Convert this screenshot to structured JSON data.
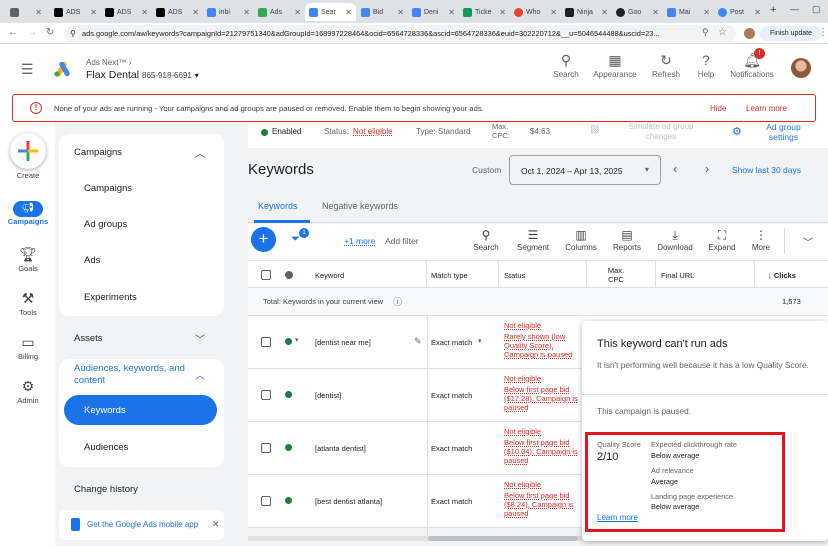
{
  "browser": {
    "tabs": [
      {
        "label": "",
        "color": "#5f6368"
      },
      {
        "label": "ADS",
        "color": "#000"
      },
      {
        "label": "ADS",
        "color": "#000"
      },
      {
        "label": "ADS",
        "color": "#000"
      },
      {
        "label": "inbi",
        "color": "#4285f4"
      },
      {
        "label": "Ads",
        "color": "#34a853"
      },
      {
        "label": "Sear",
        "color": "#4285f4"
      },
      {
        "label": "Bid",
        "color": "#4285f4"
      },
      {
        "label": "Deni",
        "color": "#4285f4"
      },
      {
        "label": "Ticke",
        "color": "#0f9d58"
      },
      {
        "label": "Who",
        "color": "#ea4335"
      },
      {
        "label": "Ninja",
        "color": "#202124"
      },
      {
        "label": "Goo",
        "color": "#202124"
      },
      {
        "label": "Mai",
        "color": "#4285f4"
      },
      {
        "label": "Post",
        "color": "#4285f4"
      }
    ],
    "url": "ads.google.com/aw/keywords?campaignId=21279751340&adGroupId=168997228464&ocid=6564728336&ascid=6564728336&euid=302220712&__u=5046544488&uscid=23...",
    "finish_update": "Finish update"
  },
  "header": {
    "product": "Ads Next™",
    "account_name": "Flax Dental",
    "account_phone": "865-918-6691",
    "search": "Search",
    "appearance": "Appearance",
    "refresh": "Refresh",
    "help": "Help",
    "notifications": "Notifications",
    "notification_count": "!"
  },
  "banner": {
    "message_bold": "None of your ads are running",
    "message": " - Your campaigns and ad groups are paused or removed. Enable them to begin showing your ads.",
    "hide": "Hide",
    "learn_more": "Learn more"
  },
  "rail": {
    "create": "Create",
    "campaigns": "Campaigns",
    "goals": "Goals",
    "tools": "Tools",
    "billing": "Billing",
    "admin": "Admin"
  },
  "nav": {
    "campaigns_section": "Campaigns",
    "campaigns": "Campaigns",
    "ad_groups": "Ad groups",
    "ads": "Ads",
    "experiments": "Experiments",
    "assets": "Assets",
    "audiences_section": "Audiences, keywords, and content",
    "keywords": "Keywords",
    "audiences": "Audiences",
    "change_history": "Change history",
    "mobile_app": "Get the Google Ads mobile app"
  },
  "status_bar": {
    "enabled": "Enabled",
    "status_label": "Status:",
    "status_value": "Not eligible",
    "type_label": "Type:",
    "type_value": "Standard",
    "max_cpc_label": "Max. CPC:",
    "max_cpc_value": "$4.63",
    "simulate": "Simulate ad group changes",
    "ad_group_settings": "Ad group settings"
  },
  "page": {
    "title": "Keywords",
    "custom": "Custom",
    "date_range": "Oct 1, 2024 – Apr 13, 2025",
    "show_last": "Show last 30 days",
    "tab_keywords": "Keywords",
    "tab_negative": "Negative keywords",
    "filter_badge": "1",
    "more_filters": "+1 more",
    "add_filter": "Add filter"
  },
  "toolbar": {
    "search": "Search",
    "segment": "Segment",
    "columns": "Columns",
    "reports": "Reports",
    "download": "Download",
    "expand": "Expand",
    "more": "More"
  },
  "table": {
    "headers": {
      "keyword": "Keyword",
      "match_type": "Match type",
      "status": "Status",
      "max_cpc": "Max. CPC",
      "final_url": "Final URL",
      "clicks": "↓ Clicks"
    },
    "total_label": "Total: Keywords in your current view",
    "total_clicks": "1,573",
    "rows": [
      {
        "keyword": "[dentist near me]",
        "match": "Exact match",
        "status1": "Not eligible",
        "status2": "Rarely shown (low Quality Score), Campaign is paused"
      },
      {
        "keyword": "[dentist]",
        "match": "Exact match",
        "status1": "Not eligible",
        "status2": "Below first page bid ($17.28), Campaign is paused"
      },
      {
        "keyword": "[atlanta dentist]",
        "match": "Exact match",
        "status1": "Not eligible",
        "status2": "Below first page bid ($10.04), Campaign is paused"
      },
      {
        "keyword": "[best dentist atlanta]",
        "match": "Exact match",
        "status1": "Not eligible",
        "status2": "Below first page bid ($8.24), Campaign is paused"
      }
    ]
  },
  "popup": {
    "title": "This keyword can't run ads",
    "body": "It isn't performing well because it has a low Quality Score.",
    "paused": "This campaign is paused.",
    "qs_label": "Quality Score",
    "qs_value": "2/10",
    "ectr_label": "Expected clickthrough rate",
    "ectr_value": "Below average",
    "ad_rel_label": "Ad relevance",
    "ad_rel_value": "Average",
    "lpe_label": "Landing page experience",
    "lpe_value": "Below average",
    "learn_more": "Learn more"
  },
  "colors": {
    "accent": "#1a73e8",
    "error": "#d93025",
    "highlight": "#e0161f",
    "enabled": "#188038"
  }
}
